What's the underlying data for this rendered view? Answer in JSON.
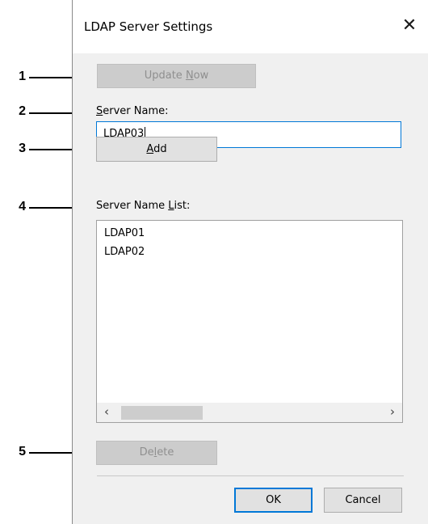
{
  "dialog": {
    "title": "LDAP Server Settings",
    "close_symbol": "✕"
  },
  "update_button": {
    "pre": "Update ",
    "key": "N",
    "post": "ow",
    "enabled": false
  },
  "server_name": {
    "label_key": "S",
    "label_rest": "erver Name:",
    "value": "LDAP03"
  },
  "add_button": {
    "key": "A",
    "post": "dd"
  },
  "server_list": {
    "label_pre": "Server Name ",
    "label_key": "L",
    "label_post": "ist:",
    "items": [
      "LDAP01",
      "LDAP02"
    ],
    "scroll_left": "‹",
    "scroll_right": "›"
  },
  "delete_button": {
    "pre": "De",
    "key": "l",
    "post": "ete",
    "enabled": false
  },
  "ok_button": {
    "label": "OK"
  },
  "cancel_button": {
    "label": "Cancel"
  },
  "callouts": [
    "1",
    "2",
    "3",
    "4",
    "5"
  ],
  "colors": {
    "accent": "#0078d7",
    "dialog_bg": "#f0f0f0",
    "disabled_text": "#8f8f8f"
  }
}
